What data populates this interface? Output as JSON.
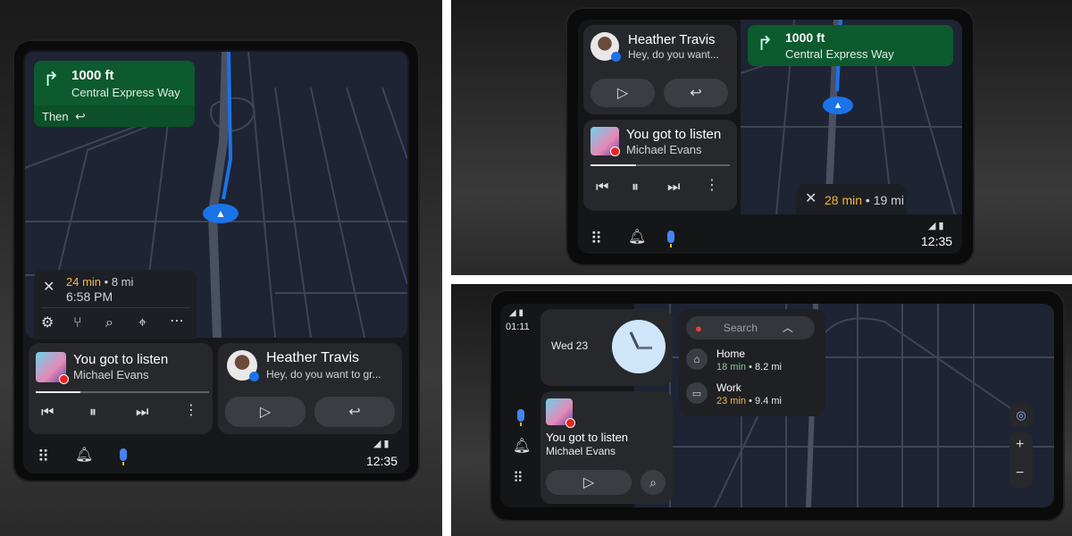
{
  "colors": {
    "nav_green": "#0d5a2e",
    "route_blue": "#1a73e8",
    "eta_amber": "#f5b640",
    "eta_green": "#81c995",
    "card": "#26282c",
    "map": "#1e2433"
  },
  "portrait": {
    "nav": {
      "distance": "1000 ft",
      "street": "Central Express Way",
      "then_label": "Then",
      "turn_icon": "turn-right-icon",
      "then_icon": "turn-left-icon"
    },
    "trip": {
      "eta": "24 min",
      "distance": "8 mi",
      "separator": "•",
      "arrival": "6:58 PM",
      "actions": [
        "gear-icon",
        "alt-route-icon",
        "search-icon",
        "pin-icon",
        "more-icon"
      ]
    },
    "media": {
      "title": "You got to listen",
      "artist": "Michael Evans",
      "progress": 0.26
    },
    "message": {
      "sender": "Heather Travis",
      "preview": "Hey, do you want to gr..."
    },
    "status": {
      "time": "12:35"
    }
  },
  "wide": {
    "message": {
      "sender": "Heather Travis",
      "preview": "Hey, do you want..."
    },
    "media": {
      "title": "You got to listen",
      "artist": "Michael Evans",
      "progress": 0.33
    },
    "nav": {
      "distance": "1000 ft",
      "street": "Central Express Way"
    },
    "trip": {
      "eta": "28 min",
      "distance": "19 mi",
      "separator": "•"
    },
    "status": {
      "time": "12:35"
    }
  },
  "ultrawide": {
    "status": {
      "time": "01:11"
    },
    "clock": {
      "date": "Wed 23"
    },
    "media": {
      "title": "You got to listen",
      "artist": "Michael Evans"
    },
    "search": {
      "placeholder": "Search",
      "destinations": [
        {
          "name": "Home",
          "eta": "18 min",
          "distance": "8.2 mi",
          "icon": "home-icon"
        },
        {
          "name": "Work",
          "eta": "23 min",
          "distance": "9.4 mi",
          "icon": "briefcase-icon"
        }
      ],
      "separator": "•"
    }
  }
}
